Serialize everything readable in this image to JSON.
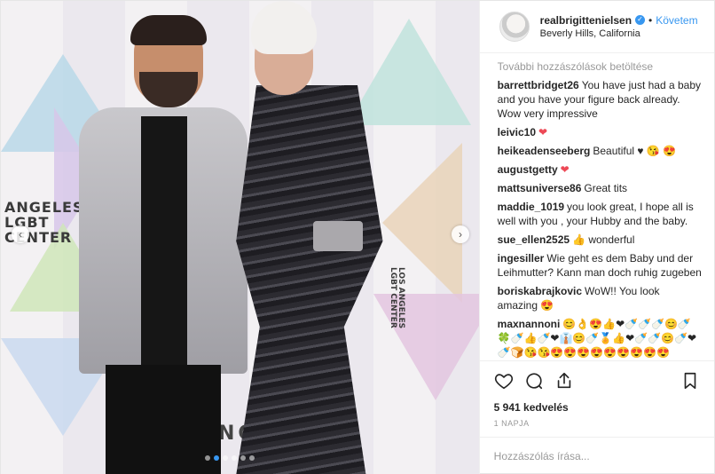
{
  "post": {
    "username": "realbrigittenielsen",
    "follow_label": "Követem",
    "location": "Beverly Hills, California",
    "photo": {
      "sign_text_a": "ANGELES\nLGBT\nCENTER",
      "sign_text_b": "LOS ANGELES LGBT CENTER",
      "sign_text_c": "NGEL WA",
      "carousel_total": 6,
      "carousel_active": 1
    }
  },
  "comments": {
    "load_more": "További hozzászólások betöltése",
    "items": [
      {
        "user": "barrettbridget26",
        "text": "You have just had a baby and you have your figure back already. Wow very impressive"
      },
      {
        "user": "leivic10",
        "text": "❤"
      },
      {
        "user": "heikeadenseeberg",
        "text": "Beautiful ♥ 😘 😍"
      },
      {
        "user": "augustgetty",
        "text": "❤"
      },
      {
        "user": "mattsuniverse86",
        "text": "Great tits"
      },
      {
        "user": "maddie_1019",
        "text": "you look great, I hope all is well with you , your Hubby and the baby."
      },
      {
        "user": "sue_ellen2525",
        "text": "👍 wonderful"
      },
      {
        "user": "ingesiller",
        "text": "Wie geht es dem Baby und der Leihmutter? Kann man doch ruhig zugeben"
      },
      {
        "user": "boriskabrajkovic",
        "text": "WoW!! You look amazing 😍"
      },
      {
        "user": "maxnannoni",
        "text": "😊👌😍👍❤🍼🍼🍼😊🍼🍀🍼👍🍼❤👔😊🍼🏅👍❤🍼🍼😊🍼❤🍼🍞😘😘😍😍😍😍😍😍😍😍😍"
      }
    ]
  },
  "actions": {
    "like_icon": "heart-icon",
    "comment_icon": "comment-icon",
    "share_icon": "share-icon",
    "save_icon": "bookmark-icon"
  },
  "likes_text": "5 941 kedvelés",
  "time_text": "1 NAPJA",
  "add_comment_placeholder": "Hozzászólás írása..."
}
